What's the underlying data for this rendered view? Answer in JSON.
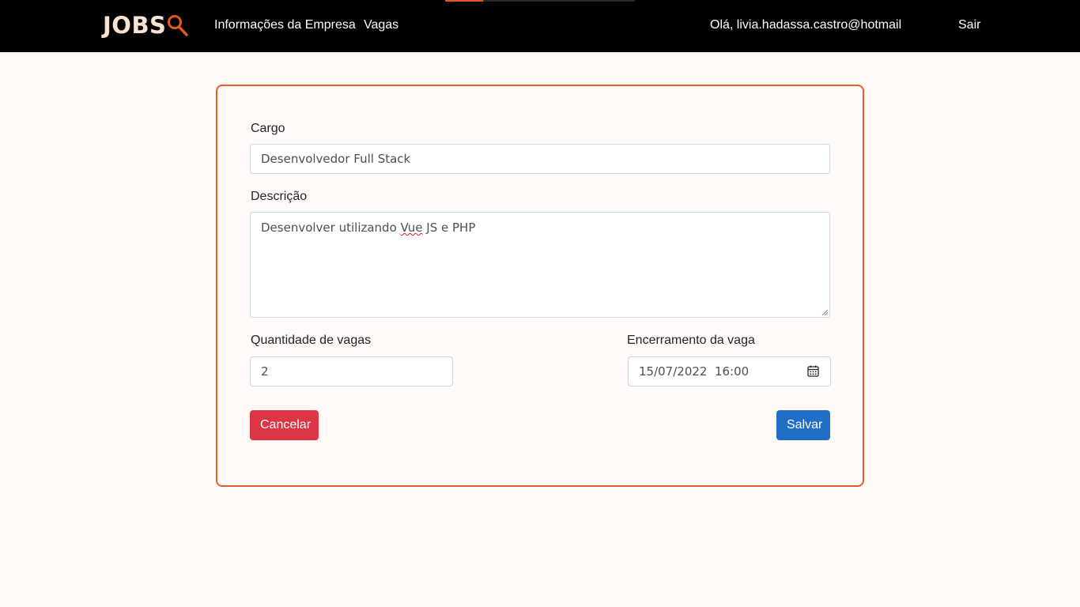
{
  "navbar": {
    "logo_text": "JOBS",
    "logo_icon": "magnifier-icon",
    "links": {
      "company": "Informações da Empresa",
      "vagas": "Vagas"
    },
    "greeting": "Olá, livia.hadassa.castro@hotmail",
    "logout": "Sair",
    "colors": {
      "background": "#000000",
      "logo": "#fbe3d2",
      "accent": "#e8561f"
    }
  },
  "form": {
    "cargo": {
      "label": "Cargo",
      "value": "Desenvolvedor Full Stack"
    },
    "descricao": {
      "label": "Descrição",
      "value_before": "Desenvolver utilizando ",
      "value_flagged": "Vue",
      "value_after": " JS e PHP"
    },
    "quantidade": {
      "label": "Quantidade de vagas",
      "value": "2"
    },
    "encerramento": {
      "label": "Encerramento da vaga",
      "value": "15/07/2022  16:00",
      "icon": "calendar-icon"
    },
    "buttons": {
      "cancel": "Cancelar",
      "save": "Salvar"
    },
    "colors": {
      "card_border": "#e35d2c",
      "cancel": "#dc3545",
      "save": "#1f6fc5"
    }
  }
}
